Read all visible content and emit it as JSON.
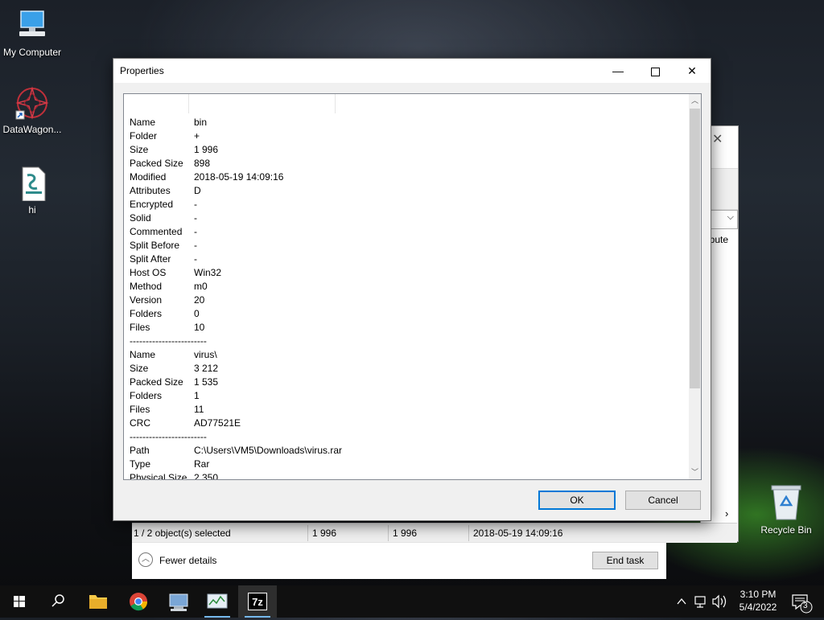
{
  "desktop": {
    "icons": [
      {
        "label": "My Computer"
      },
      {
        "label": "DataWagon..."
      },
      {
        "label": "hi"
      }
    ],
    "recycle_bin": "Recycle Bin"
  },
  "dialog": {
    "title": "Properties",
    "rows": [
      {
        "key": "Name",
        "value": "bin"
      },
      {
        "key": "Folder",
        "value": "+"
      },
      {
        "key": "Size",
        "value": "1 996"
      },
      {
        "key": "Packed Size",
        "value": "898"
      },
      {
        "key": "Modified",
        "value": "2018-05-19 14:09:16"
      },
      {
        "key": "Attributes",
        "value": "D"
      },
      {
        "key": "Encrypted",
        "value": "-"
      },
      {
        "key": "Solid",
        "value": "-"
      },
      {
        "key": "Commented",
        "value": "-"
      },
      {
        "key": "Split Before",
        "value": "-"
      },
      {
        "key": "Split After",
        "value": "-"
      },
      {
        "key": "Host OS",
        "value": "Win32"
      },
      {
        "key": "Method",
        "value": "m0"
      },
      {
        "key": "Version",
        "value": "20"
      },
      {
        "key": "Folders",
        "value": "0"
      },
      {
        "key": "Files",
        "value": "10"
      },
      {
        "key": "------------------------",
        "value": ""
      },
      {
        "key": "Name",
        "value": "virus\\"
      },
      {
        "key": "Size",
        "value": "3 212"
      },
      {
        "key": "Packed Size",
        "value": "1 535"
      },
      {
        "key": "Folders",
        "value": "1"
      },
      {
        "key": "Files",
        "value": "11"
      },
      {
        "key": "CRC",
        "value": "AD77521E"
      },
      {
        "key": "------------------------",
        "value": ""
      },
      {
        "key": "Path",
        "value": "C:\\Users\\VM5\\Downloads\\virus.rar"
      },
      {
        "key": "Type",
        "value": "Rar"
      },
      {
        "key": "Physical Size",
        "value": "2 350"
      }
    ],
    "ok_label": "OK",
    "cancel_label": "Cancel"
  },
  "background_window": {
    "partial_attr_text": "ribute",
    "status": {
      "selected": "1 / 2 object(s) selected",
      "size": "1 996",
      "packed": "1 996",
      "modified": "2018-05-19 14:09:16"
    },
    "fewer_details": "Fewer details",
    "end_task": "End task"
  },
  "taskbar": {
    "apps": [
      "start",
      "search",
      "file-explorer",
      "chrome",
      "remote-desktop",
      "task-manager",
      "7zip"
    ],
    "time": "3:10 PM",
    "date": "5/4/2022",
    "notification_count": "3"
  },
  "colors": {
    "accent": "#0078d7"
  }
}
